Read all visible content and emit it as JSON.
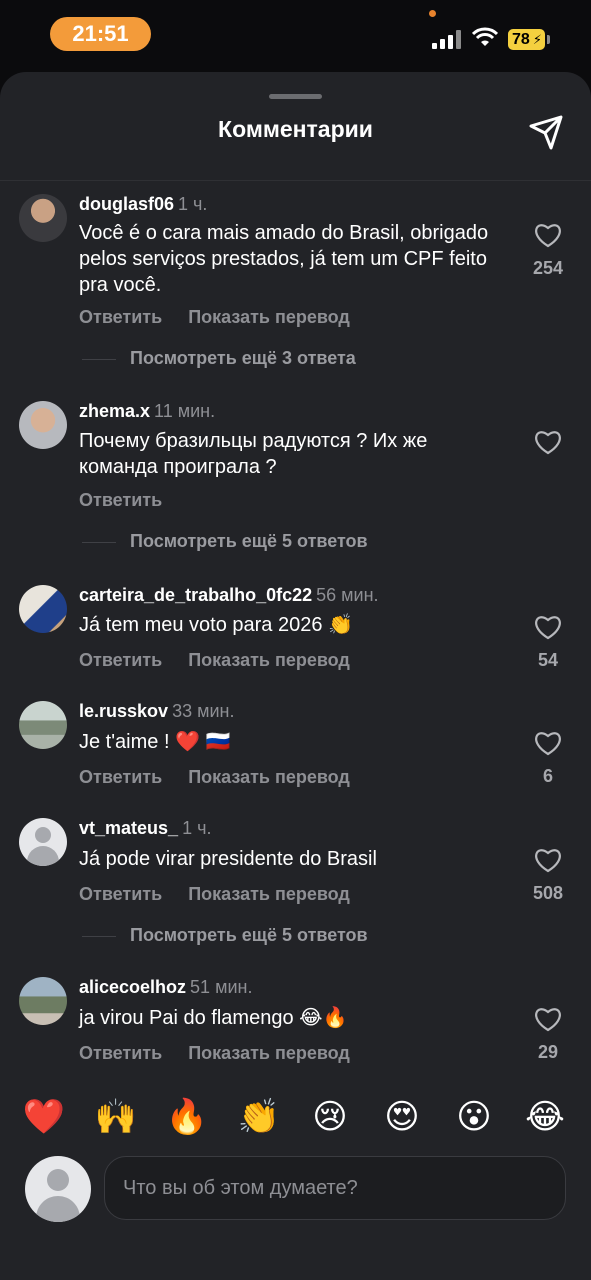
{
  "status": {
    "time": "21:51",
    "battery": "78"
  },
  "sheet": {
    "title": "Комментарии"
  },
  "actions": {
    "reply": "Ответить",
    "translate": "Показать перевод"
  },
  "comments": [
    {
      "username": "douglasf06",
      "ago": "1 ч.",
      "text": "Você é o cara mais amado do Brasil, obrigado pelos serviços prestados, já tem um CPF feito pra você.",
      "likes": "254",
      "more_replies": "Посмотреть ещё 3 ответа"
    },
    {
      "username": "zhema.x",
      "ago": "11 мин.",
      "text": "Почему бразильцы радуются ? Их же команда проиграла ?",
      "likes": "",
      "more_replies": "Посмотреть ещё 5 ответов"
    },
    {
      "username": "carteira_de_trabalho_0fc22",
      "ago": "56 мин.",
      "text": "Já tem meu voto para 2026 👏",
      "likes": "54"
    },
    {
      "username": "le.russkov",
      "ago": "33 мин.",
      "text": "Je t'aime ! ❤️ 🇷🇺",
      "likes": "6"
    },
    {
      "username": "vt_mateus_",
      "ago": "1 ч.",
      "text": "Já pode virar presidente do Brasil",
      "likes": "508",
      "more_replies": "Посмотреть ещё 5 ответов"
    },
    {
      "username": "alicecoelhoz",
      "ago": "51 мин.",
      "text": "ja virou Pai do flamengo 😂🔥",
      "likes": "29"
    }
  ],
  "reactions": [
    "❤️",
    "🙌",
    "🔥",
    "👏",
    "😢",
    "😍",
    "😮",
    "😂"
  ],
  "composer": {
    "placeholder": "Что вы об этом думаете?"
  },
  "colors": {
    "accent": "#f39b3a",
    "sheet_bg": "#222327",
    "muted_text": "#8e8f94"
  }
}
